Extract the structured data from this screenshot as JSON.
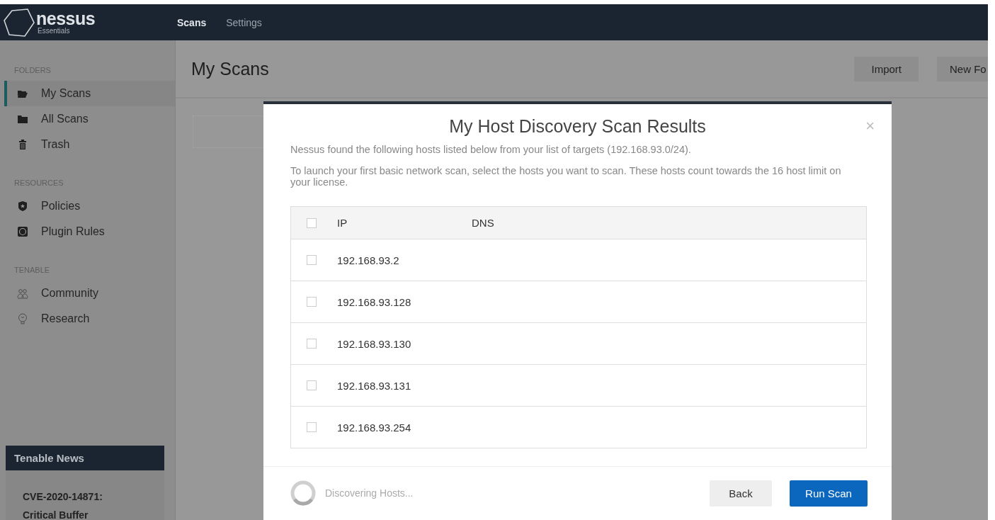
{
  "app": {
    "logo": "nessus",
    "edition": "Essentials"
  },
  "nav": [
    {
      "label": "Scans",
      "selected": true
    },
    {
      "label": "Settings",
      "selected": false
    }
  ],
  "sidebar": [
    {
      "heading": "FOLDERS",
      "items": [
        {
          "label": "My Scans",
          "selected": true
        },
        {
          "label": "All Scans",
          "selected": false
        },
        {
          "label": "Trash",
          "selected": false
        }
      ]
    },
    {
      "heading": "RESOURCES",
      "items": [
        {
          "label": "Policies",
          "selected": false
        },
        {
          "label": "Plugin Rules",
          "selected": false
        }
      ]
    },
    {
      "heading": "TENABLE",
      "items": [
        {
          "label": "Community",
          "selected": false
        },
        {
          "label": "Research",
          "selected": false
        }
      ]
    }
  ],
  "news": {
    "title": "Tenable News",
    "headline_lines": [
      "CVE-2020-14871:",
      "Critical Buffer"
    ]
  },
  "main": {
    "title": "My Scans",
    "buttons": [
      "Import",
      "New Fo"
    ]
  },
  "modal": {
    "title": "My Host Discovery Scan Results",
    "close": "×",
    "paragraphs": [
      "Nessus found the following hosts listed below from your list of targets (192.168.93.0/24).",
      "To launch your first basic network scan, select the hosts you want to scan. These hosts count towards the 16 host limit on your license."
    ],
    "table": {
      "all_checked": false,
      "columns": [
        "IP",
        "DNS"
      ],
      "rows": [
        {
          "ip": "192.168.93.2",
          "checked": false
        },
        {
          "ip": "192.168.93.128",
          "checked": false
        },
        {
          "ip": "192.168.93.130",
          "checked": false
        },
        {
          "ip": "192.168.93.131",
          "checked": false
        },
        {
          "ip": "192.168.93.254",
          "checked": false
        }
      ]
    },
    "status": "Discovering Hosts...",
    "buttons": [
      {
        "label": "Back",
        "kind": "secondary"
      },
      {
        "label": "Run Scan",
        "kind": "primary"
      }
    ]
  }
}
